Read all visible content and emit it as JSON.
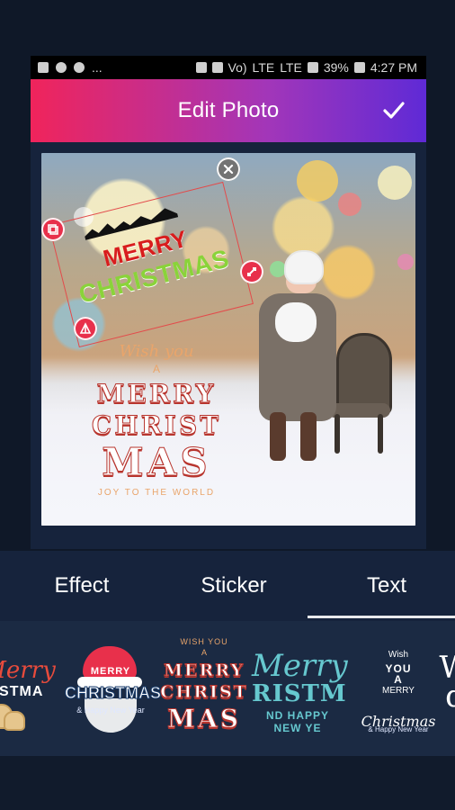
{
  "status_bar": {
    "dots": "...",
    "carrier_1": "Vo)",
    "carrier_2": "LTE",
    "carrier_3": "LTE",
    "battery": "39%",
    "time": "4:27 PM"
  },
  "header": {
    "title": "Edit Photo",
    "confirm_icon": "check-icon"
  },
  "canvas": {
    "overlay_sticker": {
      "merry": "MERRY",
      "christmas": "CHRISTMAS"
    },
    "photo_text": {
      "wish": "Wish you",
      "a": "A",
      "line1": "MERRY",
      "line2": "CHRIST",
      "line3": "MAS",
      "sub": "JOY TO THE WORLD"
    },
    "handles": {
      "close_icon": "close-icon",
      "layer_icon": "layers-icon",
      "resize_icon": "resize-icon",
      "flip_icon": "flip-icon"
    }
  },
  "tabs": {
    "items": [
      {
        "label": "Effect"
      },
      {
        "label": "Sticker"
      },
      {
        "label": "Text"
      }
    ],
    "selected_index": 2
  },
  "text_presets": [
    {
      "line1": "Merry",
      "line2": "ISTMA"
    },
    {
      "line1": "MERRY",
      "line2": "CHRISTMAS",
      "line3": "& Happy New Year"
    },
    {
      "line0": "WISH YOU",
      "line1": "A",
      "line2": "MERRY",
      "line3": "CHRIST",
      "line4": "MAS"
    },
    {
      "line1": "Merry",
      "line2": "RISTM",
      "line3": "ND HAPPY NEW YE"
    },
    {
      "line0": "Wish",
      "line1": "YOU",
      "line2": "A",
      "line3": "MERRY",
      "line4": "Christmas",
      "line5": "& Happy New Year"
    },
    {
      "line1": "W",
      "line2": "d"
    }
  ],
  "colors": {
    "header_gradient_start": "#f0245b",
    "header_gradient_mid": "#a236b9",
    "header_gradient_end": "#5f2ad6",
    "sticker_red": "#d81d1d",
    "sticker_green": "#8ad33a",
    "background": "#0f1828",
    "panel": "#16233c",
    "tab_selected": "#ffffff"
  }
}
